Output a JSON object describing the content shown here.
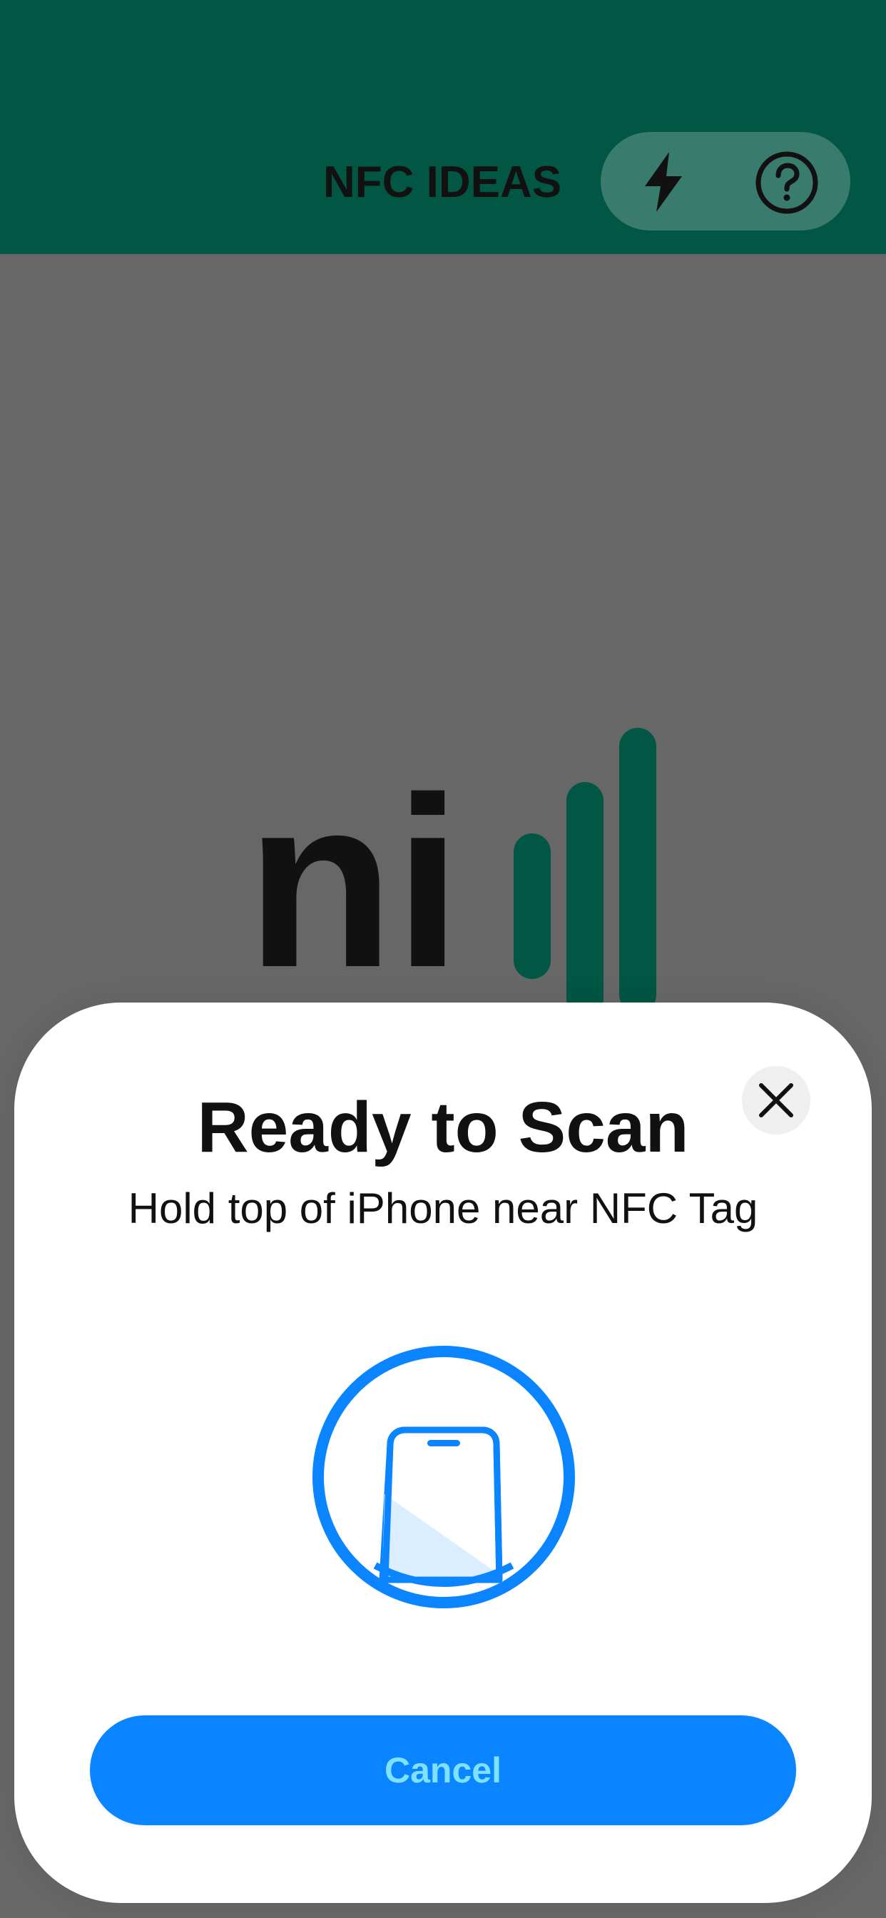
{
  "header": {
    "title": "NFC IDEAS",
    "actions": [
      {
        "icon": "lightning-bolt-icon"
      },
      {
        "icon": "question-circle-icon"
      }
    ],
    "background_color": "#025644"
  },
  "background_logo": {
    "text": "ni",
    "bars_color": "#025644"
  },
  "scan_sheet": {
    "title": "Ready to Scan",
    "subtitle": "Hold top of iPhone near NFC Tag",
    "close_icon": "close-icon",
    "graphic_icon": "iphone-scan-icon",
    "accent_color": "#0a84ff",
    "cancel_label": "Cancel"
  }
}
